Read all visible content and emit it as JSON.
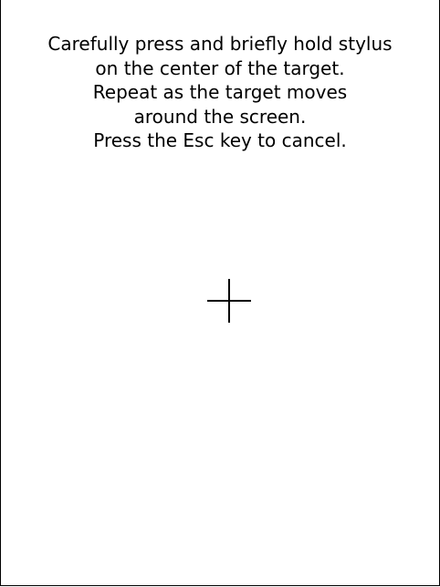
{
  "instructions": {
    "lines": [
      "Carefully press and briefly hold stylus",
      "on the center of the target.",
      "Repeat as the target moves",
      "around the screen.",
      "Press the Esc key to cancel."
    ]
  },
  "target": {
    "icon": "crosshair-icon",
    "color": "#000000"
  },
  "colors": {
    "background": "#ffffff",
    "text": "#000000",
    "border": "#000000"
  }
}
